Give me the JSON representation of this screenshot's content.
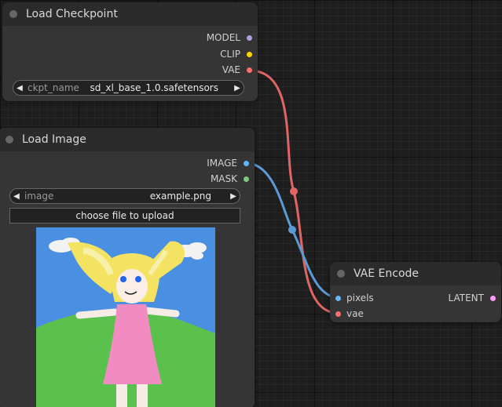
{
  "colors": {
    "model": "#b39ddb",
    "clip": "#ffd500",
    "vae": "#ff6e6e",
    "image": "#64b5f6",
    "mask": "#81c784",
    "latent": "#ff9cf9",
    "link_vae": "#e06666",
    "link_image": "#5b9bd5"
  },
  "load_checkpoint": {
    "title": "Load Checkpoint",
    "outputs": [
      "MODEL",
      "CLIP",
      "VAE"
    ],
    "widget": {
      "label": "ckpt_name",
      "value": "sd_xl_base_1.0.safetensors"
    }
  },
  "load_image": {
    "title": "Load Image",
    "outputs": [
      "IMAGE",
      "MASK"
    ],
    "widget": {
      "label": "image",
      "value": "example.png"
    },
    "upload_label": "choose file to upload"
  },
  "vae_encode": {
    "title": "VAE Encode",
    "inputs": [
      "pixels",
      "vae"
    ],
    "outputs": [
      "LATENT"
    ]
  },
  "icons": {
    "left_arrow": "◀",
    "right_arrow": "▶"
  }
}
